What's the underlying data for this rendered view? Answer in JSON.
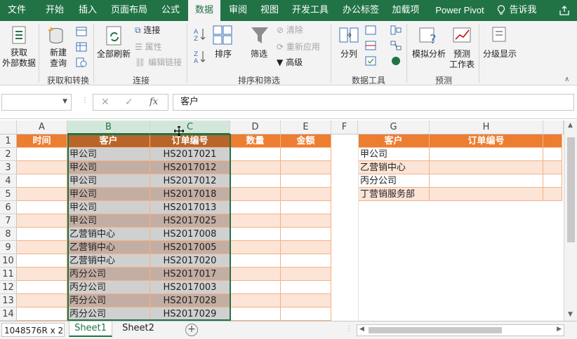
{
  "tabs": [
    "文件",
    "开始",
    "插入",
    "页面布局",
    "公式",
    "数据",
    "审阅",
    "视图",
    "开发工具",
    "办公标签",
    "加载项",
    "Power Pivot",
    "告诉我"
  ],
  "ribbon": {
    "get_external": [
      "获取",
      "外部数据"
    ],
    "new_query": [
      "新建",
      "查询"
    ],
    "refresh_all": "全部刷新",
    "connections": "连接",
    "properties": "属性",
    "edit_links": "编辑链接",
    "sort": "排序",
    "filter": "筛选",
    "clear": "清除",
    "reapply": "重新应用",
    "advanced": "高级",
    "split": "分列",
    "what_if": "模拟分析",
    "forecast": [
      "预测",
      "工作表"
    ],
    "outline": "分级显示",
    "groups": {
      "get_transform": "获取和转换",
      "connections": "连接",
      "sort_filter": "排序和筛选",
      "data_tools": "数据工具",
      "forecast": "预测"
    }
  },
  "formula_bar": {
    "content": "客户"
  },
  "columns": [
    "A",
    "B",
    "C",
    "D",
    "E",
    "F",
    "G",
    "H"
  ],
  "rows": [
    "1",
    "2",
    "3",
    "4",
    "5",
    "6",
    "7",
    "8",
    "9",
    "10",
    "11",
    "12",
    "13",
    "14"
  ],
  "table_left": {
    "headers": [
      "时间",
      "客户",
      "订单编号",
      "数量",
      "金额"
    ],
    "customers": [
      "甲公司",
      "甲公司",
      "甲公司",
      "甲公司",
      "甲公司",
      "甲公司",
      "乙营销中心",
      "乙营销中心",
      "乙营销中心",
      "丙分公司",
      "丙分公司",
      "丙分公司",
      "丙分公司"
    ],
    "orders": [
      "HS2017021",
      "HS2017012",
      "HS2017012",
      "HS2017018",
      "HS2017013",
      "HS2017025",
      "HS2017008",
      "HS2017005",
      "HS2017020",
      "HS2017017",
      "HS2017003",
      "HS2017028",
      "HS2017029"
    ]
  },
  "table_right": {
    "headers": [
      "客户",
      "订单编号"
    ],
    "customers": [
      "甲公司",
      "乙营销中心",
      "丙分公司",
      "丁营销服务部"
    ]
  },
  "status": {
    "ref": "1048576R x 2C"
  },
  "sheets": [
    "Sheet1",
    "Sheet2"
  ],
  "colors": {
    "accent": "#217346",
    "header_orange": "#ed7d31",
    "band_light": "#fce4d6"
  },
  "icons": [
    "lightbulb-icon",
    "share-icon",
    "plus-icon",
    "sort-icon",
    "filter-icon",
    "refresh-icon",
    "fx-icon",
    "cancel-icon",
    "check-icon"
  ]
}
